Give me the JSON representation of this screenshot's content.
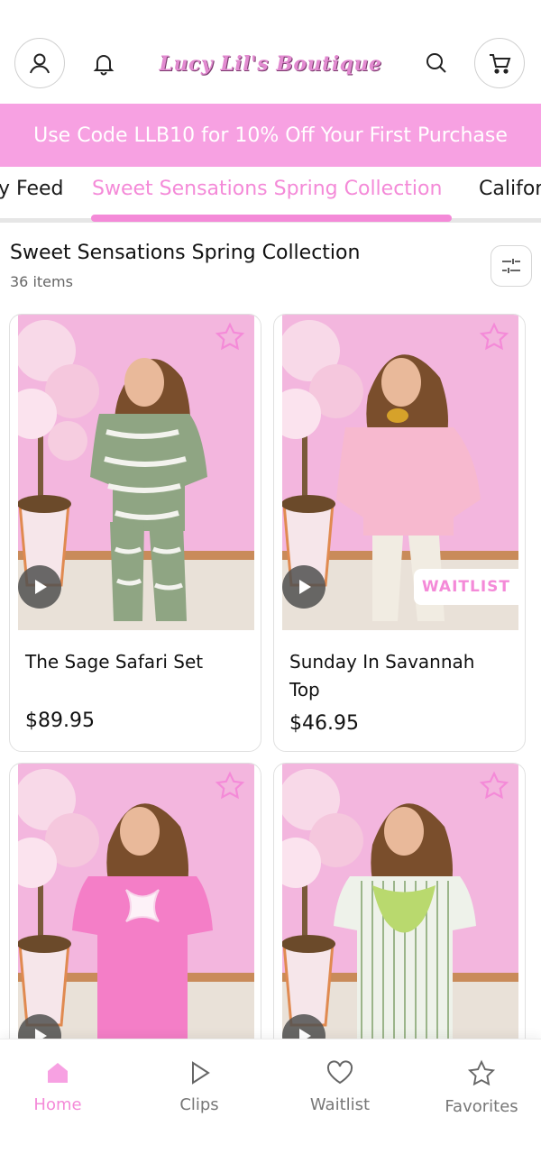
{
  "header": {
    "logo_text": "Lucy Lil's Boutique",
    "icons": {
      "account": "user-icon",
      "notifications": "bell-icon",
      "search": "search-icon",
      "cart": "cart-icon"
    }
  },
  "promo": {
    "text": "Use Code LLB10 for 10% Off Your First Purchase",
    "color": "#f7a1e2"
  },
  "tabs": [
    {
      "label": "y Feed",
      "active": false
    },
    {
      "label": "Sweet Sensations Spring Collection",
      "active": true
    },
    {
      "label": "Califor",
      "active": false
    }
  ],
  "collection": {
    "title": "Sweet Sensations Spring Collection",
    "count": "36 items"
  },
  "products": [
    {
      "name": "The Sage Safari Set",
      "price": "$89.95",
      "badge": "",
      "outfit": "sage zebra set"
    },
    {
      "name": "Sunday In Savannah Top",
      "price": "$46.95",
      "badge": "WAITLIST",
      "outfit": "pink top"
    },
    {
      "name": "",
      "price": "",
      "badge": "",
      "outfit": "pink dress"
    },
    {
      "name": "",
      "price": "",
      "badge": "",
      "outfit": "green stripe dress"
    }
  ],
  "bottom_nav": [
    {
      "label": "Home",
      "icon": "home-icon",
      "active": true
    },
    {
      "label": "Clips",
      "icon": "play-icon",
      "active": false
    },
    {
      "label": "Waitlist",
      "icon": "heart-icon",
      "active": false
    },
    {
      "label": "Favorites",
      "icon": "star-icon",
      "active": false
    }
  ],
  "colors": {
    "accent": "#f48ad8",
    "promo_bg": "#f7a1e2",
    "wall_pink": "#f3b6de"
  }
}
